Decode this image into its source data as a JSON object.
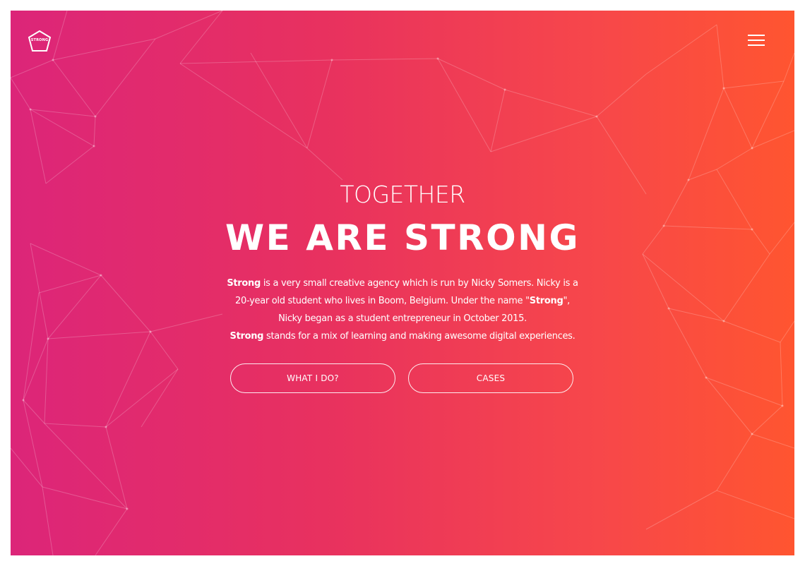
{
  "brand": {
    "logo_text": "STRONG",
    "logo_icon": "pentagon-logo-icon"
  },
  "nav": {
    "menu_icon": "hamburger-menu-icon"
  },
  "hero": {
    "eyebrow": "TOGETHER",
    "headline": "WE ARE STRONG",
    "intro": {
      "l1_bold": "Strong",
      "l1_rest": " is a very small creative agency which is run by Nicky Somers. Nicky is a",
      "l2_pre": "20-year old student who lives in Boom, Belgium. Under the name \"",
      "l2_bold": "Strong",
      "l2_post": "\",",
      "l3": "Nicky began as a student entrepreneur in October 2015.",
      "l4_bold": "Strong",
      "l4_rest": " stands for a mix of learning and making awesome digital experiences."
    }
  },
  "actions": {
    "what_label": "WHAT I DO?",
    "cases_label": "CASES"
  },
  "colors": {
    "gradient_start": "#dc2579",
    "gradient_end": "#ff5530",
    "text": "#ffffff"
  }
}
